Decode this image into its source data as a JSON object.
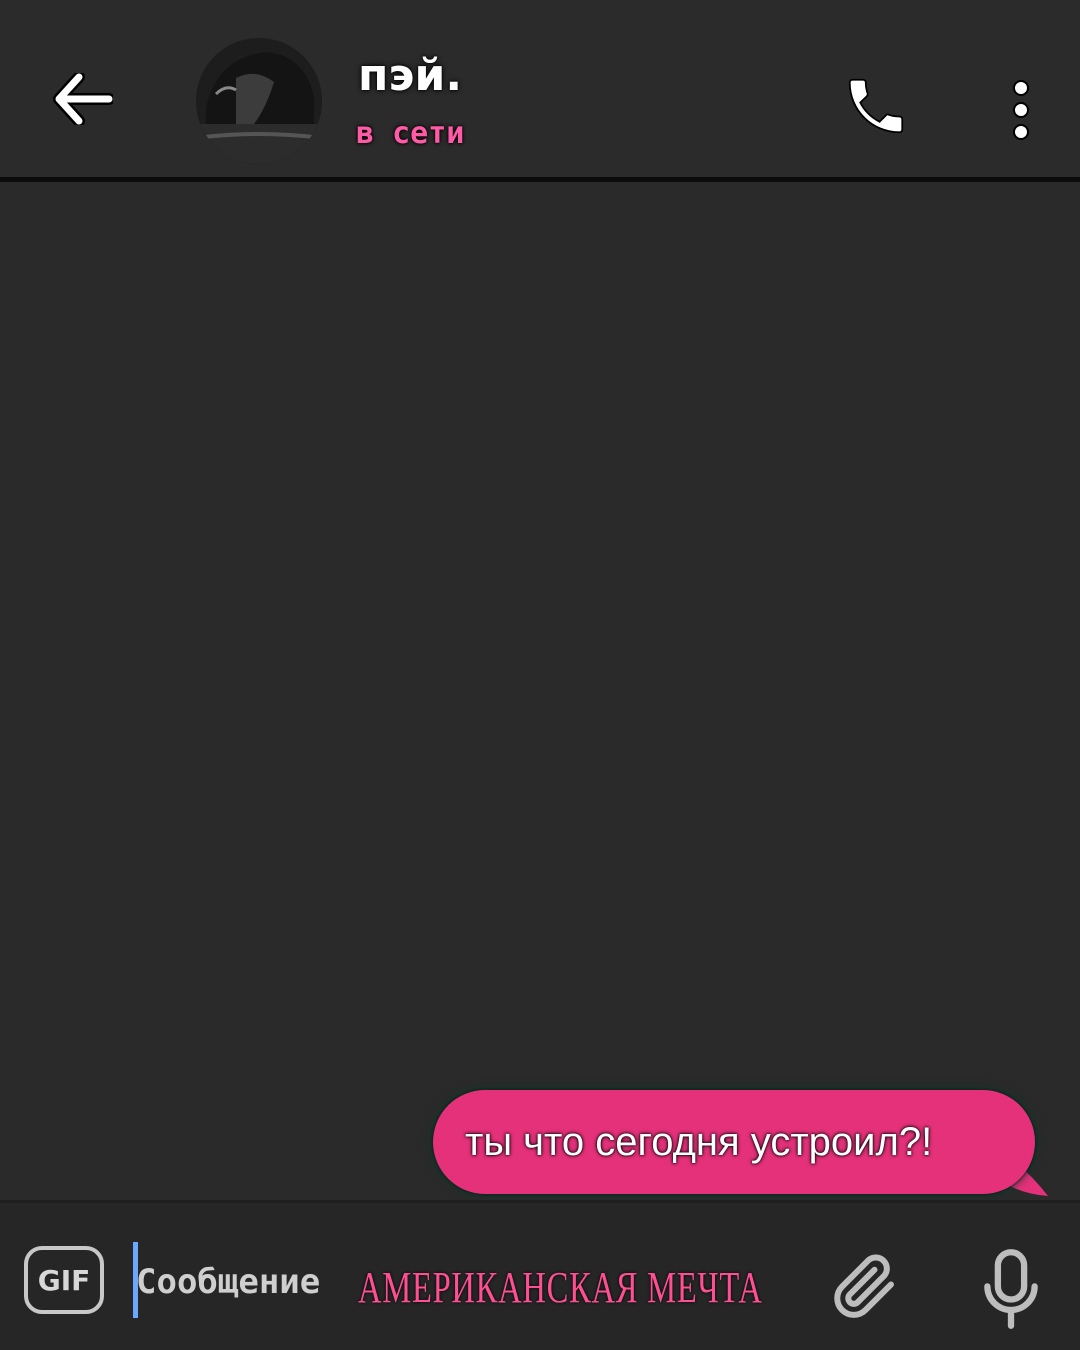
{
  "header": {
    "contact_name": "пэй.",
    "status": "в сети",
    "icons": {
      "back": "arrow-left-icon",
      "call": "phone-icon",
      "menu": "more-vertical-icon"
    }
  },
  "messages": [
    {
      "direction": "outgoing",
      "text": "ты что сегодня устроил?!"
    }
  ],
  "input": {
    "gif_label": "GIF",
    "placeholder": "Сообщение",
    "icons": {
      "attach": "paperclip-icon",
      "voice": "microphone-icon"
    }
  },
  "overlay": {
    "caption": "АМЕРИКАНСКАЯ МЕЧТА"
  },
  "colors": {
    "background": "#2a2a2a",
    "bubble": "#e5317a",
    "status": "#ff5aa6",
    "caption": "#ff4f93",
    "cursor": "#6aa8ff"
  }
}
